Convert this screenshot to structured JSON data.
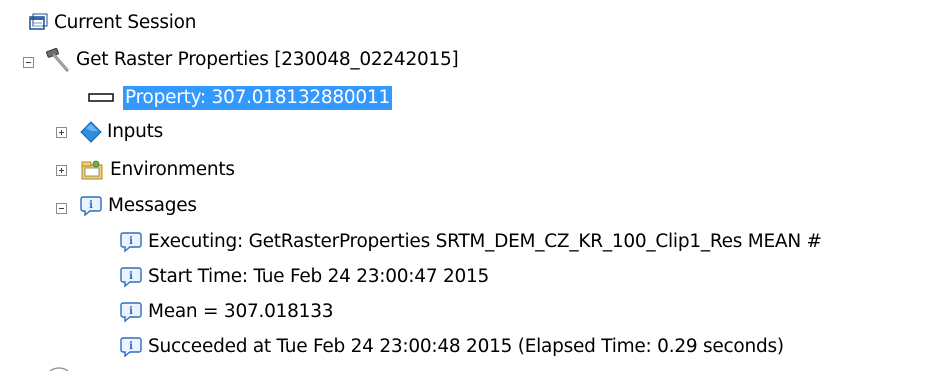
{
  "tree": {
    "session": {
      "label": "Current Session",
      "icon": "session-icon"
    },
    "tool": {
      "label": "Get Raster Properties [230048_02242015]",
      "icon": "hammer-icon",
      "expanded": true
    },
    "property": {
      "label": "Property: 307.018132880011",
      "icon": "output-parameter-icon",
      "selected": true
    },
    "inputs": {
      "label": "Inputs",
      "icon": "inputs-diamond-icon",
      "expanded": false
    },
    "environments": {
      "label": "Environments",
      "icon": "environments-folder-icon",
      "expanded": false
    },
    "messages": {
      "label": "Messages",
      "icon": "info-icon",
      "expanded": true,
      "items": [
        {
          "label": "Executing: GetRasterProperties SRTM_DEM_CZ_KR_100_Clip1_Res MEAN #",
          "icon": "info-icon"
        },
        {
          "label": "Start Time: Tue Feb 24 23:00:47 2015",
          "icon": "info-icon"
        },
        {
          "label": "Mean = 307.018133",
          "icon": "info-icon"
        },
        {
          "label": "Succeeded at Tue Feb 24 23:00:48 2015 (Elapsed Time: 0.29 seconds)",
          "icon": "info-icon"
        }
      ]
    }
  },
  "colors": {
    "selection": "#3399ff",
    "info_blue": "#2f6fb6",
    "expander_border": "#8c8c8c"
  }
}
